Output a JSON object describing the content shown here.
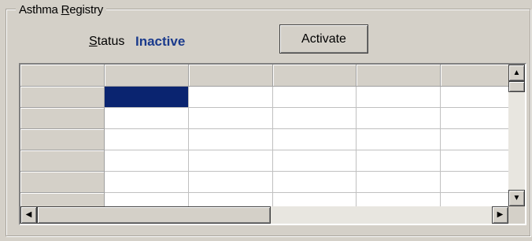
{
  "group": {
    "title_prefix": "Asthma ",
    "title_mnemonic": "R",
    "title_suffix": "egistry"
  },
  "status": {
    "label_mnemonic": "S",
    "label_rest": "tatus",
    "value": "Inactive",
    "value_color": "#1a3a8c"
  },
  "activate_button": {
    "label": "Activate"
  },
  "grid": {
    "column_count": 6,
    "visible_row_count": 6,
    "selected_cell": {
      "row": 1,
      "column": 1
    },
    "selection_color": "#0a2470",
    "cells": []
  },
  "scrollbars": {
    "up_icon": "triangle-up",
    "down_icon": "triangle-down",
    "left_icon": "triangle-left",
    "right_icon": "triangle-right"
  }
}
